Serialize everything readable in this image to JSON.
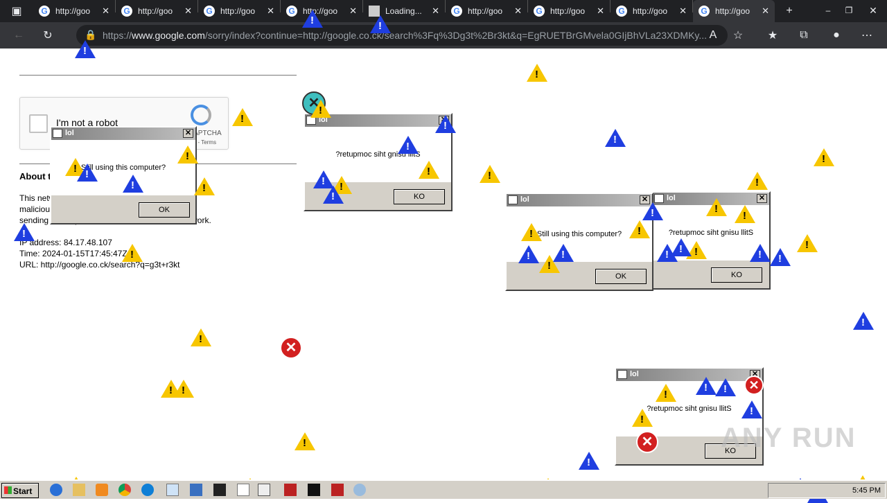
{
  "tabs": [
    {
      "title": "http://goo",
      "icon": "google-g-icon"
    },
    {
      "title": "http://goo",
      "icon": "google-g-icon"
    },
    {
      "title": "http://goo",
      "icon": "google-g-icon"
    },
    {
      "title": "http://goo",
      "icon": "google-g-icon"
    },
    {
      "title": "Loading...",
      "icon": "loading-page-icon"
    },
    {
      "title": "http://goo",
      "icon": "google-g-icon"
    },
    {
      "title": "http://goo",
      "icon": "google-g-icon"
    },
    {
      "title": "http://goo",
      "icon": "google-g-icon"
    },
    {
      "title": "http://goo",
      "icon": "google-g-icon",
      "active": true
    }
  ],
  "address": {
    "prefix": "https://",
    "host": "www.google.com",
    "path": "/sorry/index?continue=http://google.co.ck/search%3Fq%3Dg3t%2Br3kt&q=EgRUETBrGMvela0GIjBhVLa23XDMKy..."
  },
  "page": {
    "captcha_label": "I'm not a robot",
    "captcha_brand": "reCAPTCHA",
    "captcha_links": "Privacy - Terms",
    "about_heading": "About this page",
    "body_line1": "This network has sent abuse complaints about",
    "body_line2": "malicious traffic. To check if it's really a human",
    "body_line3": "sending the requests, not a robot, from this network.",
    "ip": "IP address: 84.17.48.107",
    "time": "Time: 2024-01-15T17:45:47Z",
    "url": "URL: http://google.co.ck/search?q=g3t+r3kt"
  },
  "dialogs": [
    {
      "title": "lol",
      "message": "Still using this computer?",
      "button": "OK"
    },
    {
      "title": "lol",
      "message": "?retupmoc siht gnisu llitS",
      "button": "KO"
    },
    {
      "title": "lol",
      "message": "Still using this computer?",
      "button": "OK"
    },
    {
      "title": "lol",
      "message": "?retupmoc siht gnisu llitS",
      "button": "KO"
    },
    {
      "title": "lol",
      "message": "?retupmoc siht gnisu llitS",
      "button": "KO"
    }
  ],
  "taskbar": {
    "start": "Start",
    "clock": "5:45 PM"
  },
  "watermark": "ANY RUN",
  "colors": {
    "warning": "#f7c600",
    "info": "#1f3ee0",
    "error": "#d22020",
    "chrome_dark": "#202124"
  }
}
